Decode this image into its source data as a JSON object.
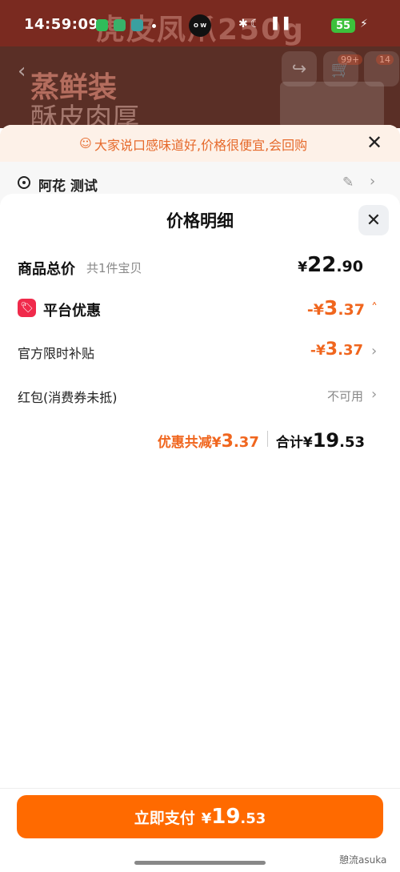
{
  "status_bar": {
    "time": "14:59:09",
    "battery": "55",
    "logo_text": "O W"
  },
  "backdrop": {
    "banner": "虎皮凤爪250g",
    "headline1": "蒸鲜装",
    "headline2": "酥皮肉厚",
    "cart_badge": "99+",
    "more_badge": "14"
  },
  "notice": {
    "text": "大家说口感味道好,价格很便宜,会回购"
  },
  "address": {
    "text": "阿花 测试"
  },
  "sheet": {
    "title": "价格明细",
    "total_label": "商品总价",
    "total_sub": "共1件宝贝",
    "total_yen": "¥",
    "total_int": "22",
    "total_dec": ".90",
    "promo_label": "平台优惠",
    "promo_prefix": "-¥",
    "promo_int": "3",
    "promo_dec": ".37",
    "subsidy_label": "官方限时补贴",
    "subsidy_prefix": "-¥",
    "subsidy_int": "3",
    "subsidy_dec": ".37",
    "redpacket_label": "红包(消费券未抵)",
    "redpacket_status": "不可用",
    "discount_label": "优惠共减¥",
    "discount_int": "3",
    "discount_dec": ".37",
    "sum_label": "合计¥",
    "sum_int": "19",
    "sum_dec": ".53"
  },
  "pay": {
    "label": "立即支付",
    "yen": "¥",
    "int": "19",
    "dec": ".53"
  },
  "watermark": "憩流asuka",
  "colors": {
    "accent": "#ff6a00",
    "discount": "#f0661e",
    "promo_icon": "#f02a4b"
  }
}
